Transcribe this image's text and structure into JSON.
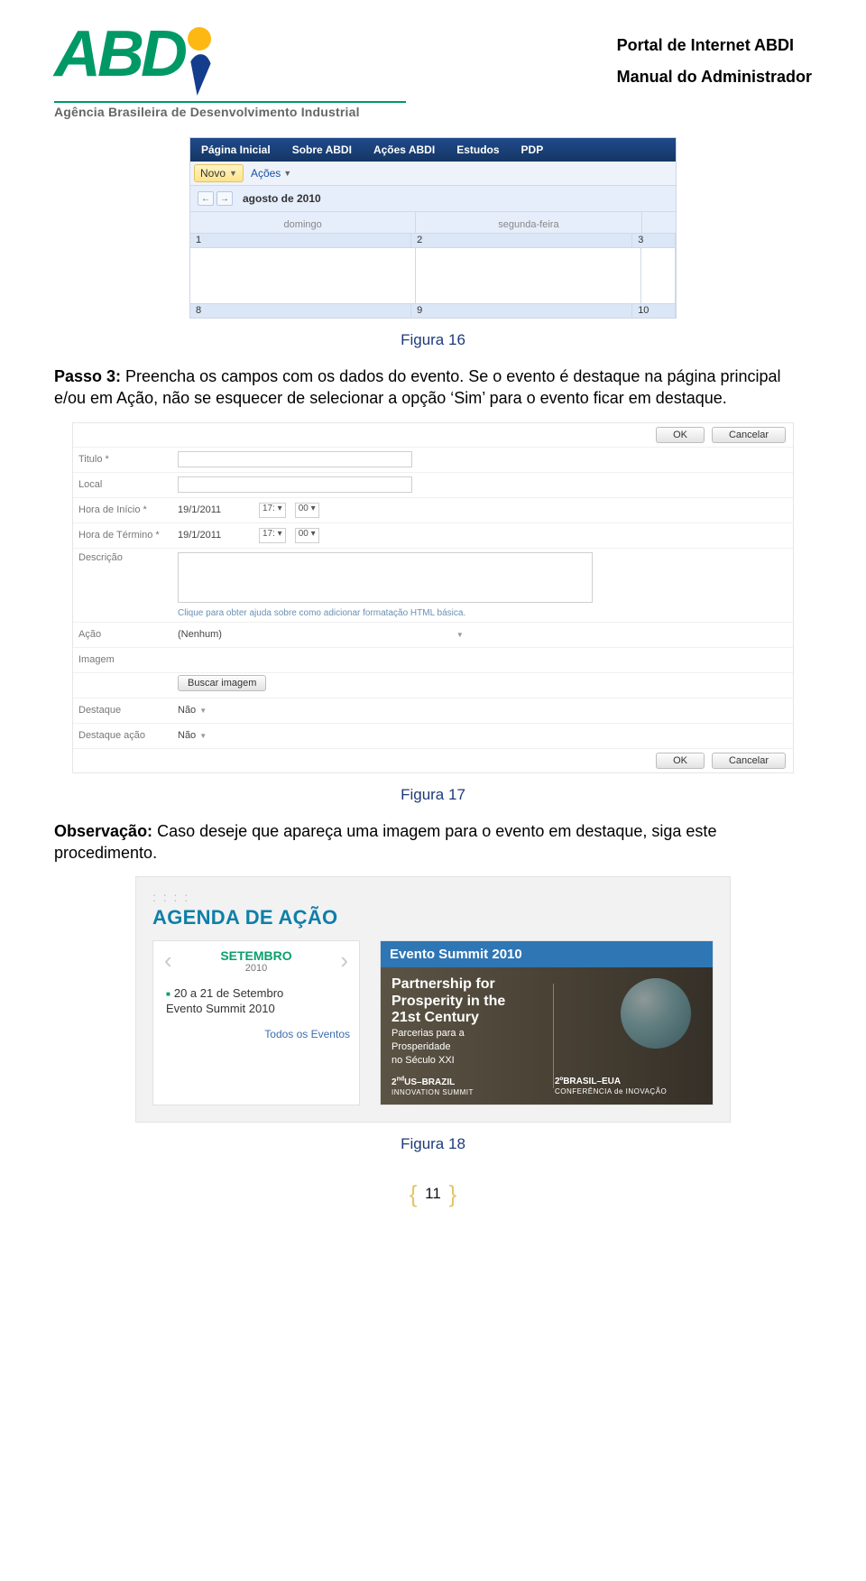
{
  "header": {
    "tagline": "Agência Brasileira de Desenvolvimento Industrial",
    "title1": "Portal de Internet ABDI",
    "title2": "Manual do Administrador"
  },
  "shot1": {
    "tabs": [
      "Página Inicial",
      "Sobre ABDI",
      "Ações ABDI",
      "Estudos",
      "PDP"
    ],
    "novo": "Novo",
    "acoes": "Ações",
    "month": "agosto de 2010",
    "day_headers": [
      "domingo",
      "segunda-feira",
      ""
    ],
    "row1": [
      "1",
      "2",
      "3"
    ],
    "row2": [
      "8",
      "9",
      "10"
    ]
  },
  "captions": {
    "fig16": "Figura 16",
    "fig17": "Figura 17",
    "fig18": "Figura 18"
  },
  "para1": {
    "lead": "Passo 3:",
    "rest": " Preencha os campos com os dados do evento. Se o evento é destaque na página principal e/ou em Ação, não se esquecer de selecionar a opção ‘Sim’ para o evento ficar em destaque."
  },
  "form": {
    "ok": "OK",
    "cancel": "Cancelar",
    "titulo": "Titulo *",
    "local": "Local",
    "hora_inicio": "Hora de Início *",
    "hora_termino": "Hora de Término *",
    "date": "19/1/2011",
    "hour": "17:",
    "minute": "00",
    "descricao": "Descrição",
    "helper": "Clique para obter ajuda sobre como adicionar formatação HTML básica.",
    "acao": "Ação",
    "acao_value": "(Nenhum)",
    "imagem": "Imagem",
    "buscar": "Buscar imagem",
    "destaque": "Destaque",
    "destaque_acao": "Destaque ação",
    "nao": "Não"
  },
  "para2": {
    "lead": "Observação:",
    "rest": " Caso deseje que apareça uma imagem para o evento em destaque, siga este procedimento."
  },
  "agenda": {
    "title": "AGENDA DE AÇÃO",
    "month": "SETEMBRO",
    "year": "2010",
    "item_date": "20 a 21 de Setembro",
    "item_name": "Evento Summit 2010",
    "todos": "Todos os Eventos",
    "right_head": "Evento Summit 2010",
    "hero_big_en1": "Partnership for",
    "hero_big_en2": "Prosperity in the",
    "hero_big_en3": "21st Century",
    "hero_pt1": "Parcerias para a",
    "hero_pt2": "Prosperidade",
    "hero_pt3": "no Século XXI",
    "sub_l1": "2",
    "sub_l1b": "US–BRAZIL",
    "sub_l1c": "INNOVATION SUMMIT",
    "sub_r1": "2ºBRASIL–EUA",
    "sub_r1b": "CONFERÊNCIA de INOVAÇÃO"
  },
  "pagenum": "11"
}
